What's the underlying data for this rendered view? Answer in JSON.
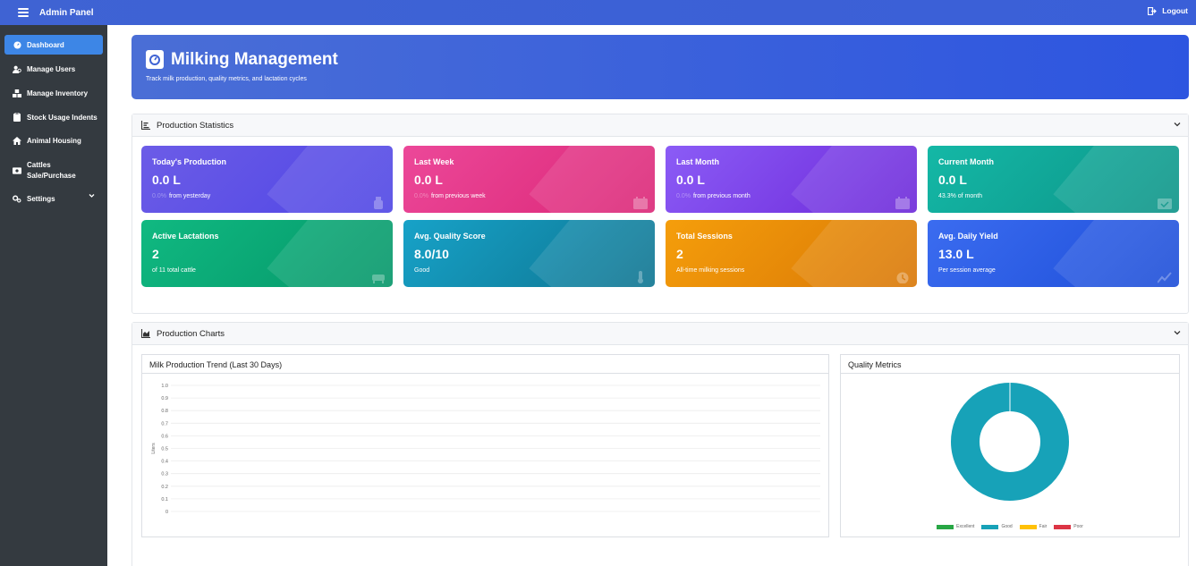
{
  "topbar": {
    "title": "Admin Panel",
    "logout_label": "Logout"
  },
  "sidebar": {
    "items": [
      {
        "label": "Dashboard",
        "icon": "dashboard-icon",
        "active": true
      },
      {
        "label": "Manage Users",
        "icon": "users-icon"
      },
      {
        "label": "Manage Inventory",
        "icon": "inventory-icon"
      },
      {
        "label": "Stock Usage Indents",
        "icon": "clipboard-icon"
      },
      {
        "label": "Animal Housing",
        "icon": "home-icon"
      },
      {
        "label": "Cattles Sale/Purchase",
        "icon": "money-icon"
      },
      {
        "label": "Settings",
        "icon": "gear-icon",
        "has_submenu": true
      }
    ]
  },
  "header": {
    "title": "Milking Management",
    "subtitle": "Track milk production, quality metrics, and lactation cycles",
    "icon": "weight-scale-icon"
  },
  "production_statistics": {
    "title": "Production Statistics",
    "cards": [
      {
        "label": "Today's Production",
        "value": "0.0 L",
        "pct": "0.0%",
        "sub": "from yesterday",
        "icon": "bottle-icon",
        "color_from": "#6c5ce7",
        "color_to": "#4f46e5"
      },
      {
        "label": "Last Week",
        "value": "0.0 L",
        "pct": "0.0%",
        "sub": "from previous week",
        "icon": "calendar-icon",
        "color_from": "#ec4899",
        "color_to": "#db2777"
      },
      {
        "label": "Last Month",
        "value": "0.0 L",
        "pct": "0.0%",
        "sub": "from previous month",
        "icon": "calendar-icon",
        "color_from": "#8b5cf6",
        "color_to": "#6d28d9"
      },
      {
        "label": "Current Month",
        "value": "0.0 L",
        "pct": "",
        "sub": "43.3% of month",
        "icon": "calendar-check-icon",
        "color_from": "#14b8a6",
        "color_to": "#0d9488"
      },
      {
        "label": "Active Lactations",
        "value": "2",
        "pct": "",
        "sub": "of 11 total cattle",
        "icon": "cow-icon",
        "color_from": "#10b981",
        "color_to": "#059669"
      },
      {
        "label": "Avg. Quality Score",
        "value": "8.0/10",
        "pct": "",
        "sub": "Good",
        "icon": "thermometer-icon",
        "color_from": "#17a2c8",
        "color_to": "#0e7490"
      },
      {
        "label": "Total Sessions",
        "value": "2",
        "pct": "",
        "sub": "All-time milking sessions",
        "icon": "clock-icon",
        "color_from": "#f59e0b",
        "color_to": "#d97706"
      },
      {
        "label": "Avg. Daily Yield",
        "value": "13.0 L",
        "pct": "",
        "sub": "Per session average",
        "icon": "trend-icon",
        "color_from": "#3b6cf0",
        "color_to": "#1d4ed8"
      }
    ]
  },
  "production_charts": {
    "title": "Production Charts",
    "trend_title": "Milk Production Trend (Last 30 Days)",
    "quality_title": "Quality Metrics"
  },
  "chart_data": [
    {
      "type": "line",
      "title": "Milk Production Trend (Last 30 Days)",
      "ylabel": "Liters",
      "xlabel": "",
      "ylim": [
        0,
        1
      ],
      "yticks": [
        "1.0",
        "0.9",
        "0.8",
        "0.7",
        "0.6",
        "0.5",
        "0.4",
        "0.3",
        "0.2",
        "0.1",
        "0"
      ],
      "x": [],
      "series": [],
      "grid": true
    },
    {
      "type": "pie",
      "title": "Quality Metrics",
      "donut": true,
      "categories": [
        "Excellent",
        "Good",
        "Fair",
        "Poor"
      ],
      "values": [
        0,
        2,
        0,
        0
      ],
      "colors": [
        "#28a745",
        "#17a2b8",
        "#ffc107",
        "#dc3545"
      ],
      "legend": "bottom"
    }
  ]
}
